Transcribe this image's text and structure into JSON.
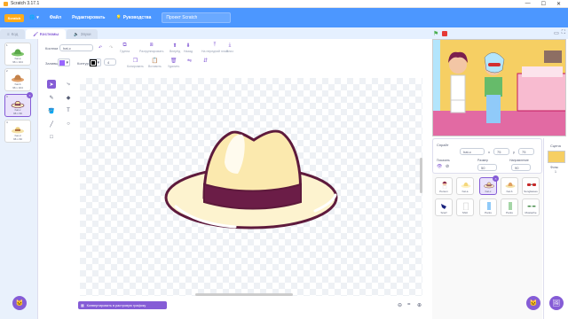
{
  "window": {
    "title": "Scratch 3.17.1",
    "controls": [
      "—",
      "☐",
      "✕"
    ]
  },
  "menu": {
    "logo": "Scratch",
    "file": "Файл",
    "edit": "Редактировать",
    "tutorials": "Руководства",
    "project_title": "Проект Scratch"
  },
  "tabs": [
    {
      "label": "Код"
    },
    {
      "label": "Костюмы"
    },
    {
      "label": "Звуки"
    }
  ],
  "costumes": [
    {
      "num": "1",
      "name": "hat-a",
      "size": "96 x 104"
    },
    {
      "num": "2",
      "name": "hat-b",
      "size": "96 x 104"
    },
    {
      "num": "3",
      "name": "hat-c",
      "size": "96 x 60"
    },
    {
      "num": "4",
      "name": "hat-d",
      "size": "96 x 60"
    }
  ],
  "toolbar": {
    "costume_label": "Костюм",
    "costume_name": "hat-c",
    "group": "Группа",
    "ungroup": "Разгруппировать",
    "forward": "Вперёд",
    "backward": "Назад",
    "front": "На передний план",
    "back": "Вниз",
    "fill_label": "Заливка",
    "outline_label": "Контур",
    "outline_size": "4",
    "copy": "Копировать",
    "paste": "Вставить",
    "delete": "Удалить"
  },
  "convert_button": "Конвертировать в растровую графику",
  "sprite_info": {
    "sprite_label": "Спрайт",
    "sprite_name": "hat-c",
    "x_label": "x",
    "x_value": "75",
    "y_label": "y",
    "y_value": "75",
    "show_label": "Показать",
    "size_label": "Размер",
    "size_value": "50",
    "direction_label": "Направление",
    "direction_value": "90"
  },
  "sprites": [
    {
      "name": "Person"
    },
    {
      "name": "hat-a"
    },
    {
      "name": "hat-c"
    },
    {
      "name": "hat-b"
    },
    {
      "name": "Sunglasses"
    },
    {
      "name": "Scarf"
    },
    {
      "name": "Shirt"
    },
    {
      "name": "Pants"
    },
    {
      "name": "Pants"
    },
    {
      "name": "Mustache"
    }
  ],
  "stage_panel": {
    "label": "Сцена",
    "backdrops_label": "Фоны",
    "backdrops_count": "1"
  },
  "colors": {
    "accent": "#855cd6",
    "menu": "#4c97ff",
    "fill": "#9966ff"
  }
}
